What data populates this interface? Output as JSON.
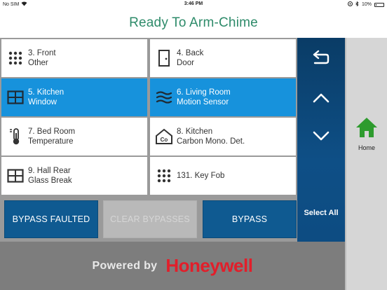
{
  "status_bar": {
    "carrier": "No SIM",
    "time": "3:46 PM",
    "battery": "10%"
  },
  "header": {
    "title": "Ready To Arm-Chime"
  },
  "zones": [
    {
      "line1": "3. Front",
      "line2": "Other",
      "icon": "keypad-icon",
      "selected": false
    },
    {
      "line1": "4. Back",
      "line2": "Door",
      "icon": "door-icon",
      "selected": false
    },
    {
      "line1": "5. Kitchen",
      "line2": "Window",
      "icon": "window-icon",
      "selected": true
    },
    {
      "line1": "6. Living Room",
      "line2": "Motion Sensor",
      "icon": "motion-icon",
      "selected": true
    },
    {
      "line1": "7. Bed Room",
      "line2": "Temperature",
      "icon": "thermometer-icon",
      "selected": false
    },
    {
      "line1": "8. Kitchen",
      "line2": "Carbon Mono. Det.",
      "icon": "co-detector-icon",
      "selected": false
    },
    {
      "line1": "9. Hall Rear",
      "line2": "Glass Break",
      "icon": "window-icon",
      "selected": false
    },
    {
      "line1": "131. Key Fob",
      "line2": "",
      "icon": "keypad-icon",
      "selected": false
    }
  ],
  "co_icon_text": "Co",
  "actions": {
    "bypass_faulted": "BYPASS FAULTED",
    "clear_bypasses": "CLEAR BYPASSES",
    "bypass": "BYPASS"
  },
  "nav": {
    "select_all": "Select All"
  },
  "home": {
    "label": "Home",
    "icon_color": "#2e9b2e"
  },
  "footer": {
    "powered_by": "Powered by",
    "brand": "Honeywell"
  },
  "colors": {
    "accent": "#1792dc",
    "title": "#2e8b6a",
    "nav_panel": "#0e4f86",
    "brand": "#e21e2a"
  }
}
